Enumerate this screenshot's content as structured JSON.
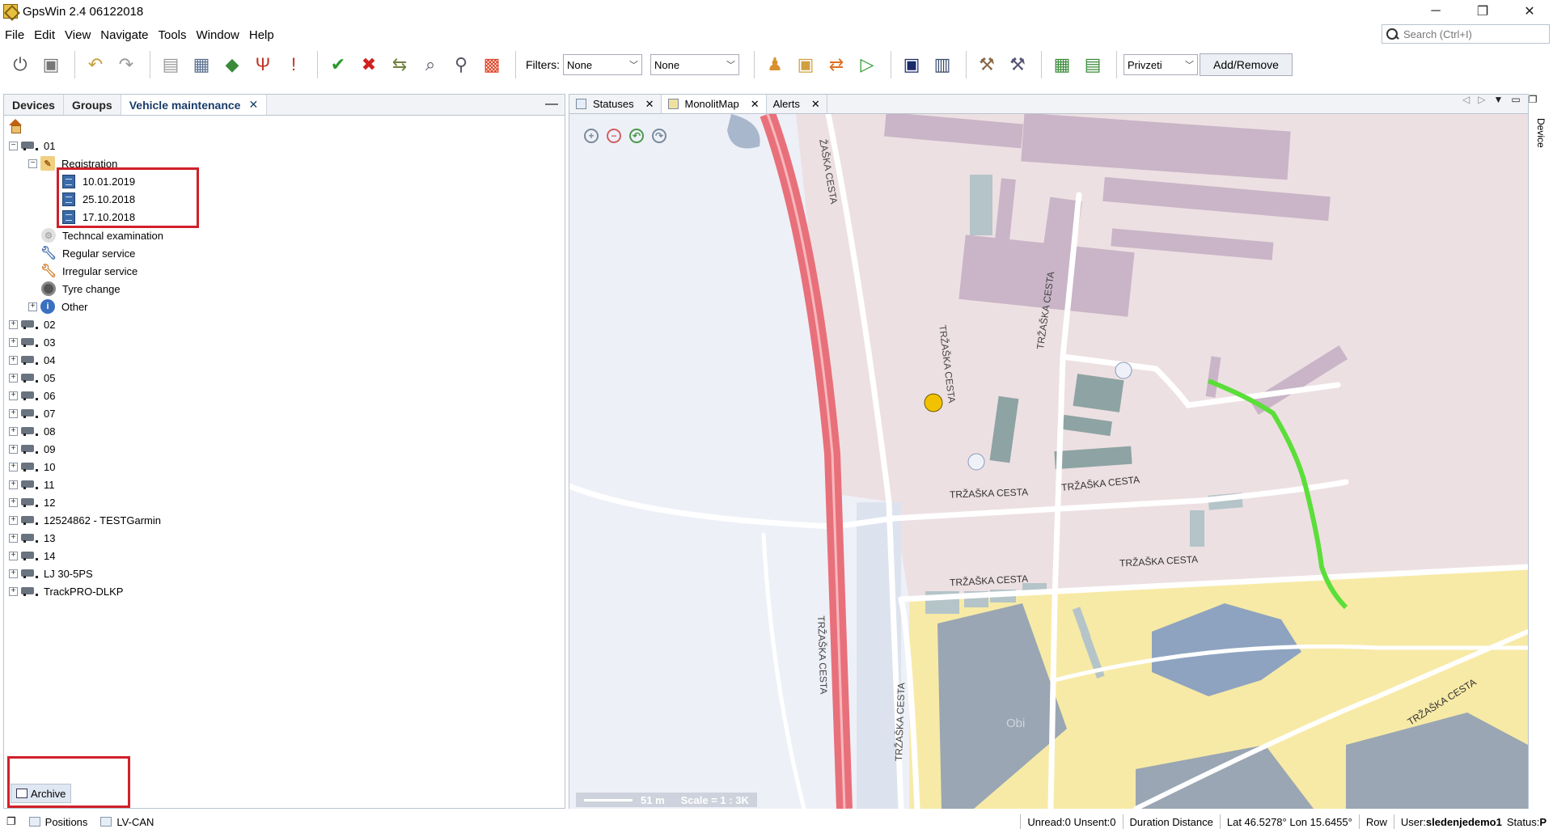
{
  "window": {
    "title": "GpsWin 2.4 06122018",
    "minimize": "─",
    "restore": "❐",
    "close": "✕"
  },
  "menu": [
    {
      "label": "File"
    },
    {
      "label": "Edit"
    },
    {
      "label": "View"
    },
    {
      "label": "Navigate"
    },
    {
      "label": "Tools"
    },
    {
      "label": "Window"
    },
    {
      "label": "Help"
    }
  ],
  "search": {
    "placeholder": "Search (Ctrl+I)"
  },
  "toolbar": {
    "filters_label": "Filters:",
    "filter1_value": "None",
    "filter2_value": "None",
    "language_value": "Privzeti",
    "add_remove_label": "Add/Remove"
  },
  "left_panel": {
    "tabs": [
      {
        "label": "Devices"
      },
      {
        "label": "Groups"
      },
      {
        "label": "Vehicle maintenance",
        "close": "✕"
      }
    ],
    "minimize": "—",
    "tree": {
      "root_vehicle": "01",
      "registration": "Registration",
      "registration_dates": [
        "10.01.2019",
        "25.10.2018",
        "17.10.2018"
      ],
      "categories": [
        "Techncal examination",
        "Regular service",
        "Irregular service",
        "Tyre change",
        "Other"
      ],
      "vehicles": [
        "02",
        "03",
        "04",
        "05",
        "06",
        "07",
        "08",
        "09",
        "10",
        "11",
        "12",
        "12524862 - TESTGarmin",
        "13",
        "14",
        "LJ 30-5PS",
        "TrackPRO-DLKP"
      ]
    },
    "archive_label": "Archive"
  },
  "map_panel": {
    "tabs": [
      {
        "label": "Statuses"
      },
      {
        "label": "MonolitMap"
      },
      {
        "label": "Alerts"
      }
    ],
    "street_labels": [
      "TRŽAŠKA CESTA",
      "TRŽAŠKA CESTA",
      "TRŽAŠKA CESTA",
      "TRŽAŠKA CESTA",
      "TRŽAŠKA CESTA",
      "TRŽAŠKA CESTA",
      "TRŽAŠKA CESTA",
      "TRŽAŠKA CESTA",
      "TRŽAŠKA CESTA",
      "ŽAŠKA CESTA"
    ],
    "poi_label": "Obi",
    "scale_distance": "51 m",
    "scale_ratio": "Scale = 1 : 3K",
    "side_tab": "Device"
  },
  "statusbar": {
    "positions": "Positions",
    "lvcan": "LV-CAN",
    "unread": "Unread:0 Unsent:0",
    "duration": "Duration Distance",
    "coords": "Lat 46.5278° Lon 15.6455°",
    "row": "Row",
    "user_label": "User:",
    "user": "sledenjedemo1",
    "status_label": "Status:",
    "status": "P"
  },
  "colors": {
    "highlight": "#d0202a",
    "route": "#5cde3a",
    "road": "#e8707a"
  }
}
